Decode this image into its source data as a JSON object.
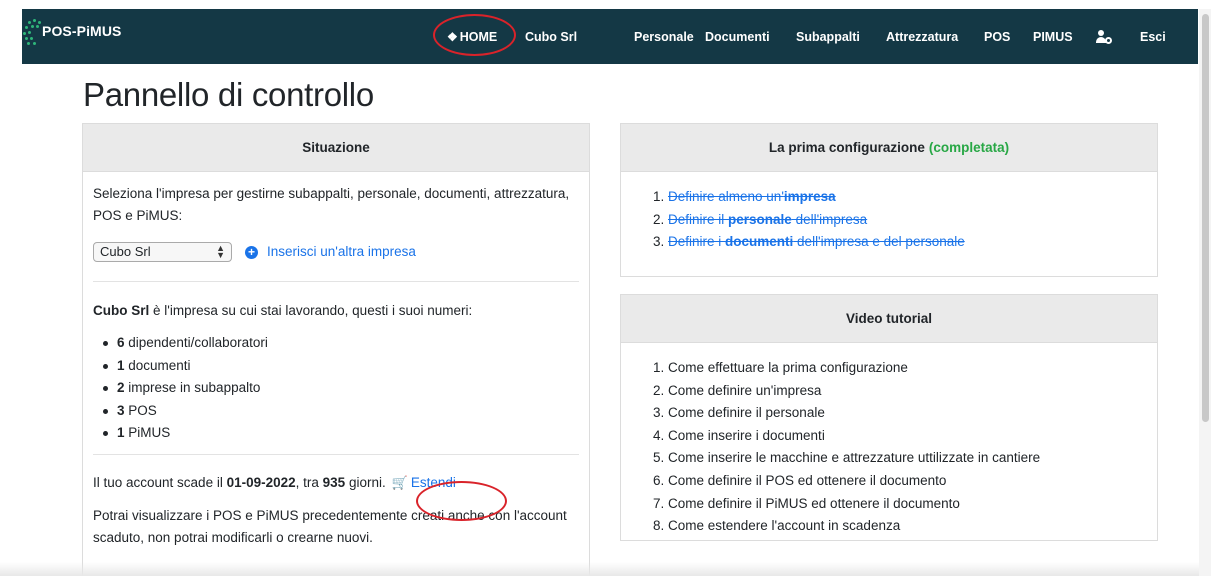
{
  "brand": {
    "name": "POS-PiMUS"
  },
  "nav": {
    "home": "HOME",
    "company": "Cubo Srl",
    "items": [
      "Personale",
      "Documenti",
      "Subappalti",
      "Attrezzatura",
      "POS",
      "PIMUS"
    ],
    "logout": "Esci"
  },
  "page": {
    "title": "Pannello di controllo"
  },
  "situazione": {
    "header": "Situazione",
    "intro": "Seleziona l'impresa per gestirne subappalti, personale, documenti, attrezzatura, POS e PiMUS:",
    "select_value": "Cubo Srl",
    "add_link": "Inserisci un'altra impresa",
    "company_name": "Cubo Srl",
    "company_text": " è l'impresa su cui stai lavorando, questi i suoi numeri:",
    "stats": [
      {
        "num": "6",
        "label": " dipendenti/collaboratori"
      },
      {
        "num": "1",
        "label": " documenti"
      },
      {
        "num": "2",
        "label": " imprese in subappalto"
      },
      {
        "num": "3",
        "label": " POS"
      },
      {
        "num": "1",
        "label": " PiMUS"
      }
    ],
    "expiry_prefix": "Il tuo account scade il ",
    "expiry_date": "01-09-2022",
    "expiry_mid": ", tra ",
    "expiry_days": "935",
    "expiry_suffix": " giorni.",
    "extend_link": "Estendi",
    "note": "Potrai visualizzare i POS e PiMUS precedentemente creati anche con l'account scaduto, non potrai modificarli o crearne nuovi."
  },
  "config": {
    "header": "La prima configurazione",
    "status": "(completata)",
    "steps": [
      {
        "a": "Definire almeno un'",
        "b": "impresa",
        "c": ""
      },
      {
        "a": "Definire il ",
        "b": "personale",
        "c": " dell'impresa"
      },
      {
        "a": "Definire i ",
        "b": "documenti",
        "c": " dell'impresa e del personale"
      }
    ]
  },
  "videos": {
    "header": "Video tutorial",
    "items": [
      "Come effettuare la prima configurazione",
      "Come definire un'impresa",
      "Come definire il personale",
      "Come inserire i documenti",
      "Come inserire le macchine e attrezzature uttilizzate in cantiere",
      "Come definire il POS ed ottenere il documento",
      "Come definire il PiMUS ed ottenere il documento",
      "Come estendere l'account in scadenza"
    ]
  },
  "colors": {
    "navbar": "#143845",
    "accent": "#1a73e8",
    "success": "#28a745",
    "highlight": "#d9232a"
  }
}
